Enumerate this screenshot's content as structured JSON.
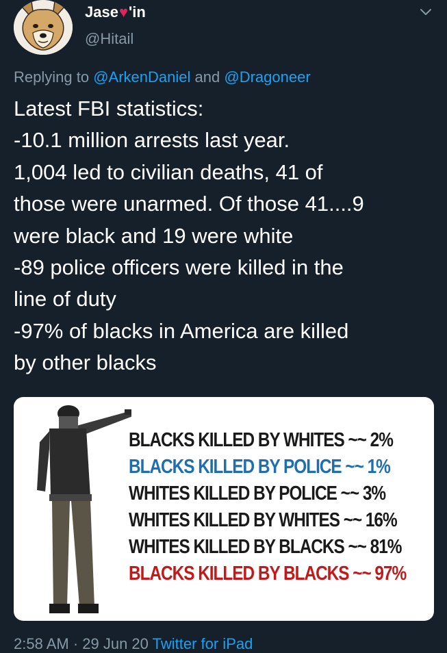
{
  "author": {
    "display_name_start": "Jase",
    "display_name_heart": "♥",
    "display_name_end": "'in",
    "handle": "@Hitail"
  },
  "reply": {
    "prefix": "Replying to",
    "user1": "@ArkenDaniel",
    "conjunction": "and",
    "user2": "@Dragoneer"
  },
  "tweet_lines": [
    "Latest FBI statistics:",
    "-10.1 million arrests last year.",
    "1,004 led to civilian deaths, 41 of",
    "those were unarmed. Of those 41....9",
    "were black and 19 were white",
    "-89 police officers were killed in the",
    "line of duty",
    "-97% of blacks in America are killed",
    "by other blacks"
  ],
  "media": {
    "lines": [
      {
        "text": "BLACKS KILLED BY WHITES ~~ 2%",
        "color": "#1a1a1a"
      },
      {
        "text": "BLACKS KILLED BY POLICE ~~ 1%",
        "color": "#1f6fb0"
      },
      {
        "text": "WHITES KILLED BY POLICE ~~ 3%",
        "color": "#1a1a1a"
      },
      {
        "text": "WHITES KILLED BY WHITES ~~ 16%",
        "color": "#1a1a1a"
      },
      {
        "text": "WHITES KILLED BY BLACKS ~~ 81%",
        "color": "#1a1a1a"
      },
      {
        "text": "BLACKS KILLED BY BLACKS ~~ 97%",
        "color": "#c21a1a"
      }
    ]
  },
  "footer": {
    "time_text": "2:58 AM · 29 Jun 20",
    "source_text": "Twitter for iPad"
  },
  "colors": {
    "background": "#15202b",
    "accent": "#1da1f2",
    "muted": "#8899a6",
    "heart": "#e0245e"
  }
}
